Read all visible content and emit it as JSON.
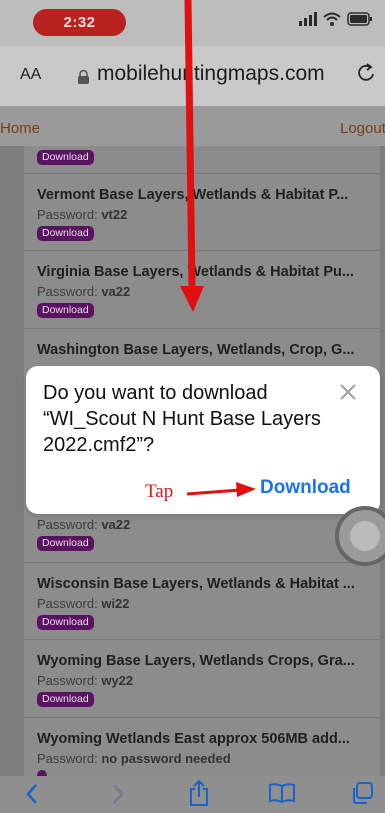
{
  "status": {
    "time": "2:32"
  },
  "browser": {
    "text_size_label": "AA",
    "url": "mobilehuntingmaps.com"
  },
  "site_nav": {
    "home": "Home",
    "logout": "Logout"
  },
  "list": {
    "top_badge": "Download",
    "items": [
      {
        "title": "Vermont Base Layers, Wetlands & Habitat P...",
        "password_label": "Password:",
        "password": "vt22",
        "badge": "Download"
      },
      {
        "title": "Virginia Base Layers, Wetlands & Habitat Pu...",
        "password_label": "Password:",
        "password": "va22",
        "badge": "Download"
      },
      {
        "title": "Washington Base Layers, Wetlands, Crop, G...",
        "password_label": "",
        "password": "",
        "badge": ""
      },
      {
        "title": "",
        "password_label": "Password:",
        "password": "va22",
        "badge": "Download"
      },
      {
        "title": "Wisconsin Base Layers, Wetlands & Habitat ...",
        "password_label": "Password:",
        "password": "wi22",
        "badge": "Download"
      },
      {
        "title": "Wyoming Base Layers, Wetlands Crops, Gra...",
        "password_label": "Password:",
        "password": "wy22",
        "badge": "Download"
      },
      {
        "title": "Wyoming Wetlands East approx 506MB add...",
        "password_label": "Password:",
        "password": "no password needed",
        "badge": ""
      }
    ]
  },
  "dialog": {
    "message": "Do you want to download “WI_Scout N Hunt Base Layers 2022.cmf2”?",
    "download_label": "Download"
  },
  "annotation": {
    "tap_label": "Tap",
    "color": "#e01010"
  },
  "colors": {
    "badge": "#5a1361",
    "link": "#1a73e8",
    "nav_link": "#7a3e16"
  },
  "toolbar": {
    "icons": [
      "back-icon",
      "forward-icon",
      "share-icon",
      "bookmarks-icon",
      "tabs-icon"
    ]
  }
}
